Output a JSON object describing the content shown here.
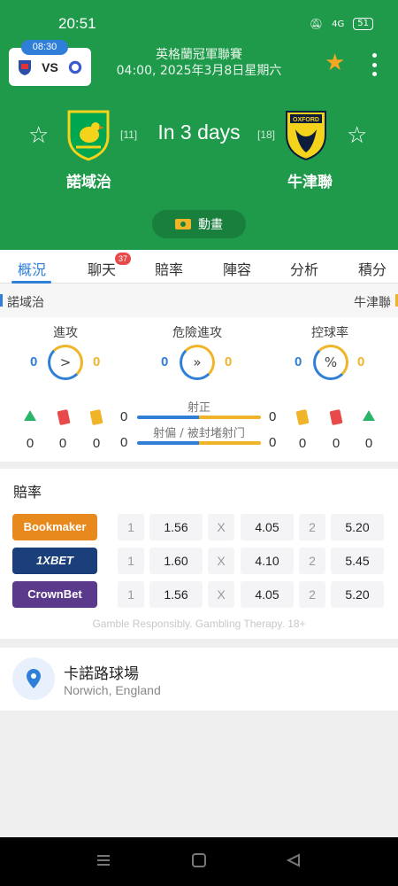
{
  "status": {
    "time": "20:51",
    "battery": "51",
    "signal_text": "4G"
  },
  "match_card": {
    "kickoff": "08:30",
    "vs": "VS"
  },
  "header": {
    "league": "英格蘭冠軍聯賽",
    "datetime": "04:00, 2025年3月8日星期六",
    "countdown": "In 3 days",
    "anim_label": "動畫"
  },
  "home": {
    "name": "諾域治",
    "rank": "[11]"
  },
  "away": {
    "name": "牛津聯",
    "rank": "[18]"
  },
  "tabs": [
    {
      "label": "概況",
      "active": true
    },
    {
      "label": "聊天",
      "badge": "37"
    },
    {
      "label": "賠率"
    },
    {
      "label": "陣容"
    },
    {
      "label": "分析"
    },
    {
      "label": "積分榜"
    }
  ],
  "stats": {
    "attack": {
      "label": "進攻",
      "home": "0",
      "away": "0",
      "icon": ">"
    },
    "danger": {
      "label": "危險進攻",
      "home": "0",
      "away": "0",
      "icon": "»"
    },
    "possession": {
      "label": "控球率",
      "home": "0",
      "away": "0",
      "icon": "%"
    },
    "events": {
      "home": {
        "corners": "0",
        "red": "0",
        "yellow": "0"
      },
      "away": {
        "corners": "0",
        "red": "0",
        "yellow": "0"
      }
    },
    "shots_on": {
      "label": "射正",
      "home": "0",
      "away": "0"
    },
    "shots_off": {
      "label": "射偏 / 被封堵射门",
      "home": "0",
      "away": "0"
    }
  },
  "odds": {
    "title": "賠率",
    "rows": [
      {
        "bookmaker": "Bookmaker",
        "color": "#e8891d",
        "l1": "1",
        "v1": "1.56",
        "lx": "X",
        "vx": "4.05",
        "l2": "2",
        "v2": "5.20"
      },
      {
        "bookmaker": "1XBET",
        "color": "#1b3f7a",
        "l1": "1",
        "v1": "1.60",
        "lx": "X",
        "vx": "4.10",
        "l2": "2",
        "v2": "5.45"
      },
      {
        "bookmaker": "CrownBet",
        "color": "#5b3a8c",
        "l1": "1",
        "v1": "1.56",
        "lx": "X",
        "vx": "4.05",
        "l2": "2",
        "v2": "5.20"
      }
    ],
    "disclaimer": "Gamble Responsibly. Gambling Therapy. 18+"
  },
  "venue": {
    "name": "卡諾路球場",
    "location": "Norwich, England"
  },
  "colors": {
    "green": "#1f9a4a",
    "accent_blue": "#2f7fd8",
    "accent_yellow": "#f0b429"
  }
}
